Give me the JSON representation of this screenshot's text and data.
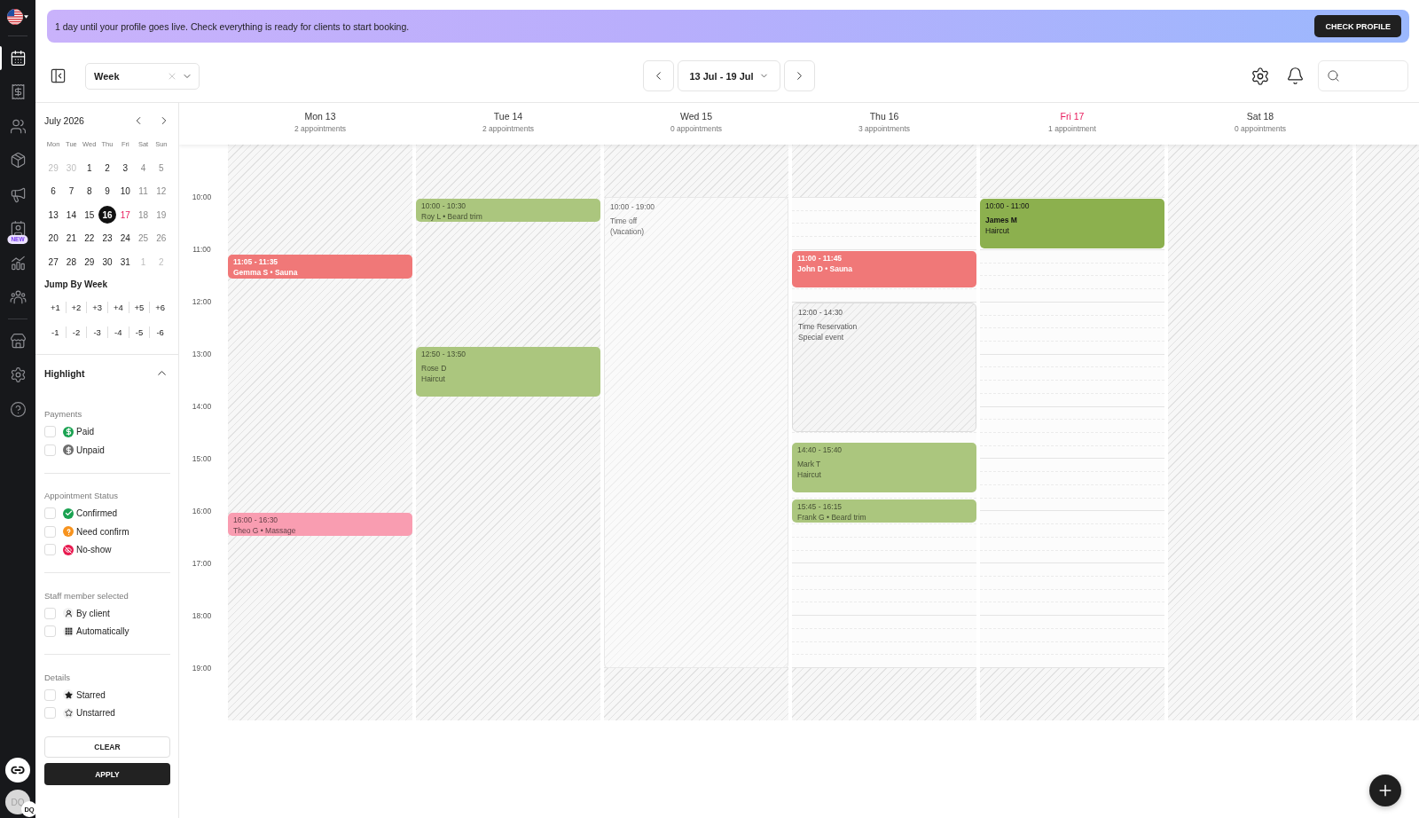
{
  "rail": {
    "groups": [
      {
        "items": [
          {
            "kind": "calendar",
            "selected": true
          },
          {
            "kind": "receipt",
            "selected": false
          },
          {
            "kind": "clients",
            "selected": false
          },
          {
            "kind": "products",
            "selected": false
          },
          {
            "kind": "marketing",
            "selected": false
          },
          {
            "kind": "profile",
            "selected": false,
            "badge": "NEW"
          },
          {
            "kind": "reports",
            "selected": false
          },
          {
            "kind": "team",
            "selected": false
          }
        ]
      },
      {
        "items": [
          {
            "kind": "store",
            "selected": false
          },
          {
            "kind": "settings",
            "selected": false
          },
          {
            "kind": "help",
            "selected": false
          }
        ]
      }
    ],
    "avatar": {
      "initials": "DQ",
      "badge": "DQ"
    }
  },
  "banner": {
    "text": "1 day until your profile goes live. Check everything is ready for clients to start booking.",
    "button": "CHECK PROFILE"
  },
  "toolbar": {
    "view": "Week",
    "date_range": "13 Jul - 19 Jul"
  },
  "mini_calendar": {
    "title": "July 2026",
    "weekdays": [
      "Mon",
      "Tue",
      "Wed",
      "Thu",
      "Fri",
      "Sat",
      "Sun"
    ],
    "days": [
      {
        "label": "29",
        "outside": true,
        "selected": false,
        "today": false
      },
      {
        "label": "30",
        "outside": true,
        "selected": false,
        "today": false
      },
      {
        "label": "1",
        "outside": false,
        "selected": false,
        "today": false
      },
      {
        "label": "2",
        "outside": false,
        "selected": false,
        "today": false
      },
      {
        "label": "3",
        "outside": false,
        "selected": false,
        "today": false
      },
      {
        "label": "4",
        "outside": false,
        "selected": false,
        "today": false
      },
      {
        "label": "5",
        "outside": false,
        "selected": false,
        "today": false
      },
      {
        "label": "6",
        "outside": false,
        "selected": false,
        "today": false
      },
      {
        "label": "7",
        "outside": false,
        "selected": false,
        "today": false
      },
      {
        "label": "8",
        "outside": false,
        "selected": false,
        "today": false
      },
      {
        "label": "9",
        "outside": false,
        "selected": false,
        "today": false
      },
      {
        "label": "10",
        "outside": false,
        "selected": false,
        "today": false
      },
      {
        "label": "11",
        "outside": false,
        "selected": false,
        "today": false
      },
      {
        "label": "12",
        "outside": false,
        "selected": false,
        "today": false
      },
      {
        "label": "13",
        "outside": false,
        "selected": false,
        "today": false
      },
      {
        "label": "14",
        "outside": false,
        "selected": false,
        "today": false
      },
      {
        "label": "15",
        "outside": false,
        "selected": false,
        "today": false
      },
      {
        "label": "16",
        "outside": false,
        "selected": true,
        "today": false
      },
      {
        "label": "17",
        "outside": false,
        "selected": false,
        "today": true
      },
      {
        "label": "18",
        "outside": false,
        "selected": false,
        "today": false
      },
      {
        "label": "19",
        "outside": false,
        "selected": false,
        "today": false
      },
      {
        "label": "20",
        "outside": false,
        "selected": false,
        "today": false
      },
      {
        "label": "21",
        "outside": false,
        "selected": false,
        "today": false
      },
      {
        "label": "22",
        "outside": false,
        "selected": false,
        "today": false
      },
      {
        "label": "23",
        "outside": false,
        "selected": false,
        "today": false
      },
      {
        "label": "24",
        "outside": false,
        "selected": false,
        "today": false
      },
      {
        "label": "25",
        "outside": false,
        "selected": false,
        "today": false
      },
      {
        "label": "26",
        "outside": false,
        "selected": false,
        "today": false
      },
      {
        "label": "27",
        "outside": false,
        "selected": false,
        "today": false
      },
      {
        "label": "28",
        "outside": false,
        "selected": false,
        "today": false
      },
      {
        "label": "29",
        "outside": false,
        "selected": false,
        "today": false
      },
      {
        "label": "30",
        "outside": false,
        "selected": false,
        "today": false
      },
      {
        "label": "31",
        "outside": false,
        "selected": false,
        "today": false
      },
      {
        "label": "1",
        "outside": true,
        "selected": false,
        "today": false
      },
      {
        "label": "2",
        "outside": true,
        "selected": false,
        "today": false
      }
    ]
  },
  "jump_by_week": {
    "title": "Jump By Week",
    "forward": [
      "+1",
      "+2",
      "+3",
      "+4",
      "+5",
      "+6"
    ],
    "back": [
      "-1",
      "-2",
      "-3",
      "-4",
      "-5",
      "-6"
    ]
  },
  "highlight": {
    "title": "Highlight",
    "expanded": true,
    "groups": [
      {
        "title": "Payments",
        "items": [
          {
            "label": "Paid",
            "kind": "dollar",
            "color": "#1aa251",
            "checked": false
          },
          {
            "label": "Unpaid",
            "kind": "dollar",
            "color": "#6e6e6e",
            "checked": false
          }
        ]
      },
      {
        "title": "Appointment Status",
        "items": [
          {
            "label": "Confirmed",
            "kind": "check",
            "color": "#1aa251",
            "checked": false
          },
          {
            "label": "Need confirm",
            "kind": "question",
            "color": "#f7931e",
            "checked": false
          },
          {
            "label": "No-show",
            "kind": "eye_off",
            "color": "#e8194f",
            "checked": false
          }
        ]
      },
      {
        "title": "Staff member selected",
        "items": [
          {
            "label": "By client",
            "kind": "person",
            "checked": false
          },
          {
            "label": "Automatically",
            "kind": "grid",
            "checked": false
          }
        ]
      },
      {
        "title": "Details",
        "items": [
          {
            "label": "Starred",
            "kind": "star",
            "checked": false
          },
          {
            "label": "Unstarred",
            "kind": "star_outline",
            "checked": false
          }
        ]
      }
    ],
    "clear": "CLEAR",
    "apply": "APPLY"
  },
  "calendar": {
    "hours": [
      "10:00",
      "11:00",
      "12:00",
      "13:00",
      "14:00",
      "15:00",
      "16:00",
      "17:00",
      "18:00",
      "19:00"
    ],
    "days": [
      {
        "name": "Mon 13",
        "count": "2 appointments",
        "today": false,
        "closed": true,
        "events": [
          {
            "kind": "appointment",
            "time": "11:05 - 11:35",
            "details": [
              "Gemma S • Sauna"
            ],
            "color": "#f07878"
          },
          {
            "kind": "appointment",
            "time": "16:00 - 16:30",
            "details": [
              "Theo G • Massage"
            ],
            "color": "#f99db1"
          }
        ]
      },
      {
        "name": "Tue 14",
        "count": "2 appointments",
        "today": false,
        "closed": true,
        "events": [
          {
            "kind": "appointment",
            "time": "10:00 - 10:30",
            "details": [
              "Roy L • Beard trim"
            ],
            "color": "#abc67e"
          },
          {
            "kind": "appointment",
            "time": "12:50 - 13:50",
            "details": [
              "Rose D",
              "Haircut"
            ],
            "color": "#abc67e"
          }
        ]
      },
      {
        "name": "Wed 15",
        "count": "0 appointments",
        "today": false,
        "closed": false,
        "events": [
          {
            "kind": "time_off",
            "time": "10:00 - 19:00",
            "details": [
              "Time off",
              "(Vacation)"
            ]
          }
        ]
      },
      {
        "name": "Thu 16",
        "count": "3 appointments",
        "today": false,
        "closed": false,
        "events": [
          {
            "kind": "appointment",
            "time": "11:00 - 11:45",
            "details": [
              "John D • Sauna"
            ],
            "color": "#f07878"
          },
          {
            "kind": "reservation",
            "time": "12:00 - 14:30",
            "details": [
              "Time Reservation",
              "Special event"
            ]
          },
          {
            "kind": "appointment",
            "time": "14:40 - 15:40",
            "details": [
              "Mark T",
              "Haircut"
            ],
            "color": "#abc67e"
          },
          {
            "kind": "appointment",
            "time": "15:45 - 16:15",
            "details": [
              "Frank G • Beard trim"
            ],
            "color": "#abc67e"
          }
        ]
      },
      {
        "name": "Fri 17",
        "count": "1 appointment",
        "today": true,
        "closed": false,
        "events": [
          {
            "kind": "appointment",
            "time": "10:00 - 11:00",
            "details": [
              "James M",
              "Haircut"
            ],
            "color": "#8cb04e"
          }
        ]
      },
      {
        "name": "Sat 18",
        "count": "0 appointments",
        "today": false,
        "closed": true
      },
      {
        "closed": true
      }
    ]
  }
}
